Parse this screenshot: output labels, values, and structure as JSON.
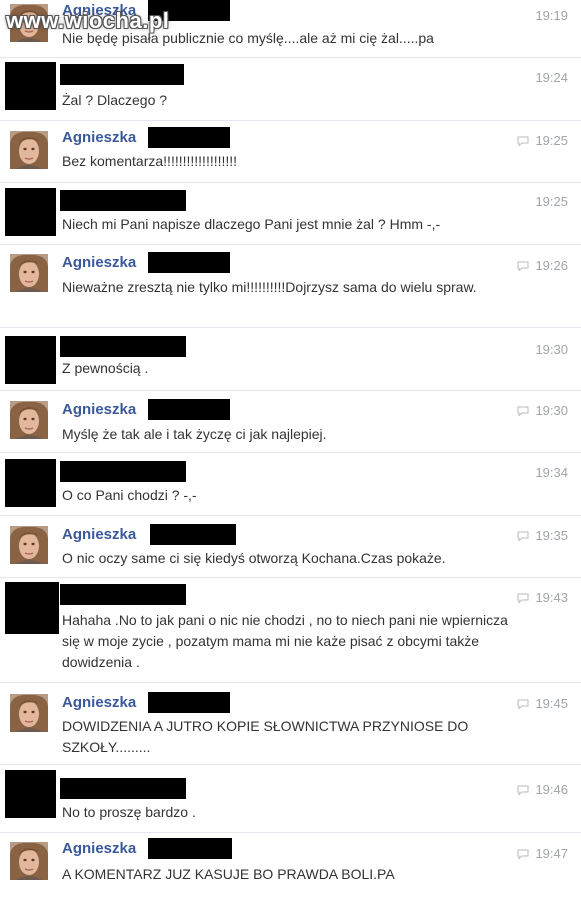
{
  "watermark": "www.wiocha.pl",
  "ack_icon": "seen-bubble-icon",
  "colors": {
    "name": "#3b5998",
    "time": "#a0a4ab",
    "text": "#333333",
    "redaction": "#000000"
  },
  "messages": [
    {
      "sender": "Agnieszka",
      "time": "19:19",
      "text": "Nie będę pisała publicznie co myślę....ale aż mi cię żal.....pa"
    },
    {
      "sender": "",
      "time": "19:24",
      "text": "Żal ? Dlaczego ?"
    },
    {
      "sender": "Agnieszka",
      "time": "19:25",
      "text": "Bez komentarza!!!!!!!!!!!!!!!!!!!"
    },
    {
      "sender": "",
      "time": "19:25",
      "text": "Niech mi Pani napisze dlaczego Pani jest mnie żal ? Hmm -,-"
    },
    {
      "sender": "Agnieszka",
      "time": "19:26",
      "text": "Nieważne zresztą nie tylko mi!!!!!!!!!!Dojrzysz sama do wielu spraw."
    },
    {
      "sender": "",
      "time": "19:30",
      "text": "Z pewnością ."
    },
    {
      "sender": "Agnieszka",
      "time": "19:30",
      "text": "Myślę że tak ale i tak życzę ci jak najlepiej."
    },
    {
      "sender": "",
      "time": "19:34",
      "text": "O co Pani chodzi ? -,-"
    },
    {
      "sender": "Agnieszka",
      "time": "19:35",
      "text": "O nic oczy same ci się kiedyś otworzą Kochana.Czas pokaże."
    },
    {
      "sender": "",
      "time": "19:43",
      "text": "Hahaha .No to jak pani o nic nie chodzi , no to niech pani nie wpiernicza się w moje zycie , pozatym mama mi nie każe pisać z obcymi także dowidzenia ."
    },
    {
      "sender": "Agnieszka",
      "time": "19:45",
      "text": "DOWIDZENIA A JUTRO KOPIE SŁOWNICTWA PRZYNIOSE DO SZKOŁY........."
    },
    {
      "sender": "",
      "time": "19:46",
      "text": "No to proszę bardzo ."
    },
    {
      "sender": "Agnieszka",
      "time": "19:47",
      "text": "A KOMENTARZ JUZ KASUJE BO PRAWDA BOLI.PA"
    }
  ]
}
